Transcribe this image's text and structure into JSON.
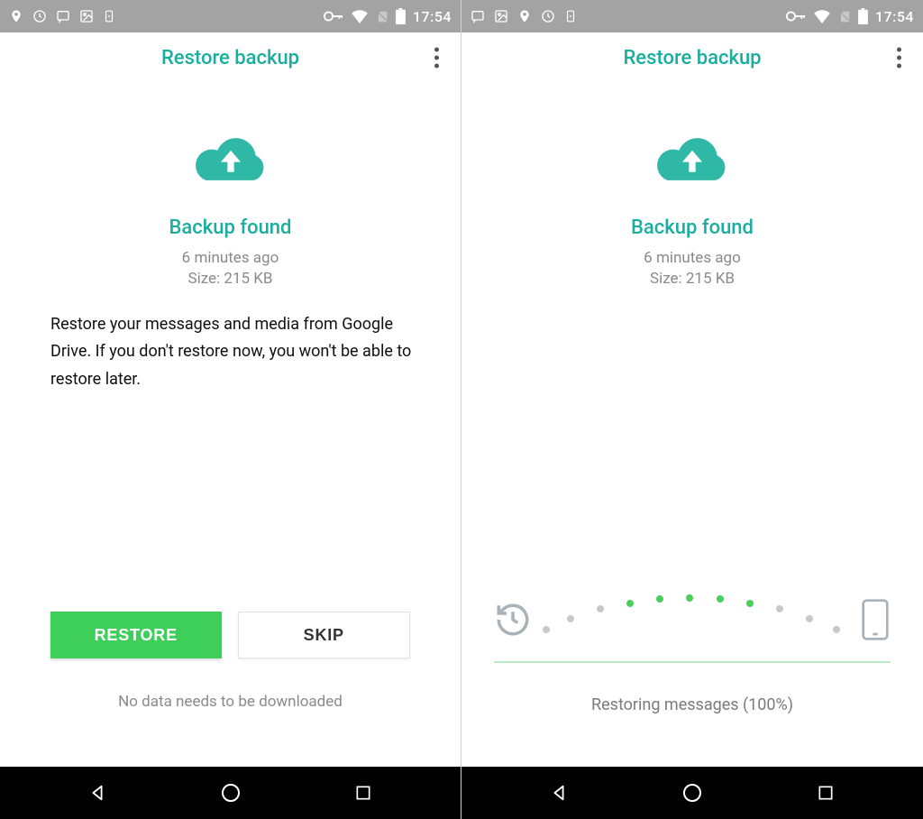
{
  "status": {
    "time": "17:54"
  },
  "left": {
    "title": "Restore backup",
    "heading": "Backup found",
    "time_ago": "6 minutes ago",
    "size": "Size: 215 KB",
    "description": "Restore your messages and media from Google Drive. If you don't restore now, you won't be able to restore later.",
    "restore_label": "RESTORE",
    "skip_label": "SKIP",
    "footnote": "No data needs to be downloaded"
  },
  "right": {
    "title": "Restore backup",
    "heading": "Backup found",
    "time_ago": "6 minutes ago",
    "size": "Size: 215 KB",
    "progress_percent": 100,
    "status_text": "Restoring messages (100%)"
  },
  "colors": {
    "teal": "#1aae9f",
    "green_btn": "#3ecf5b",
    "gray": "#8a8a8a",
    "status_bg": "#a3a3a3"
  }
}
